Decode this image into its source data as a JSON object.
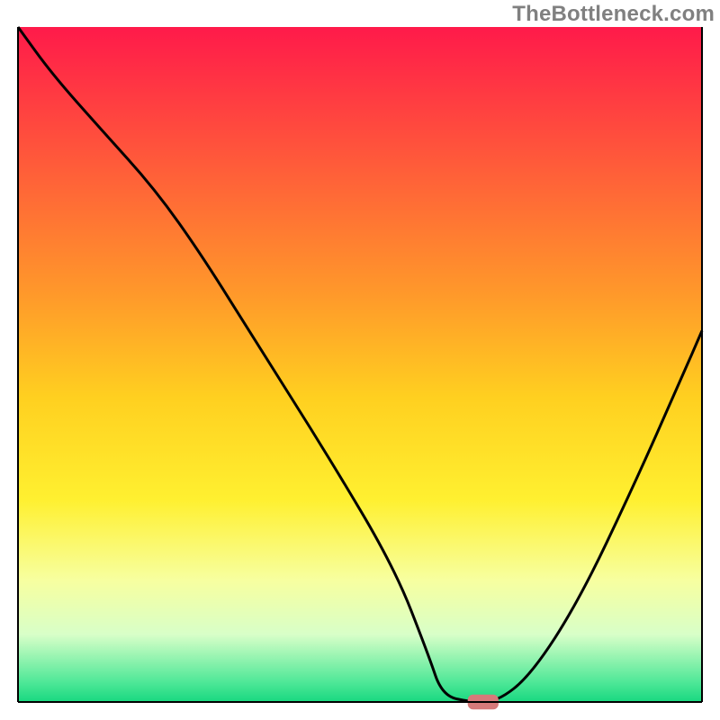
{
  "watermark": "TheBottleneck.com",
  "chart_data": {
    "type": "line",
    "title": "",
    "xlabel": "",
    "ylabel": "",
    "xlim": [
      0,
      100
    ],
    "ylim": [
      0,
      100
    ],
    "grid": false,
    "legend": false,
    "axes_visible": {
      "x_ticks": false,
      "y_ticks": false,
      "left_spine": true,
      "right_spine": true,
      "bottom_spine": true,
      "top_spine": false
    },
    "background_gradient": {
      "type": "vertical",
      "stops": [
        {
          "pos": 0.0,
          "color": "#ff1a4a"
        },
        {
          "pos": 0.2,
          "color": "#ff5a3a"
        },
        {
          "pos": 0.4,
          "color": "#ff9a2a"
        },
        {
          "pos": 0.55,
          "color": "#ffd020"
        },
        {
          "pos": 0.7,
          "color": "#fff030"
        },
        {
          "pos": 0.82,
          "color": "#f7ffa0"
        },
        {
          "pos": 0.9,
          "color": "#d8ffc8"
        },
        {
          "pos": 0.97,
          "color": "#50e898"
        },
        {
          "pos": 1.0,
          "color": "#18d880"
        }
      ]
    },
    "series": [
      {
        "name": "bottleneck-curve",
        "color": "#000000",
        "x": [
          0,
          5,
          12,
          20,
          27,
          35,
          45,
          55,
          60,
          62,
          66,
          70,
          75,
          82,
          90,
          97,
          100
        ],
        "y": [
          100,
          93,
          85,
          76,
          66,
          53,
          37,
          20,
          7,
          1,
          0,
          0,
          4,
          15,
          32,
          48,
          55
        ]
      }
    ],
    "markers": [
      {
        "name": "optimal-marker",
        "shape": "rounded-rect",
        "color": "#d67a7a",
        "cx": 68,
        "cy": 0,
        "w": 4.5,
        "h": 2.2
      }
    ]
  }
}
